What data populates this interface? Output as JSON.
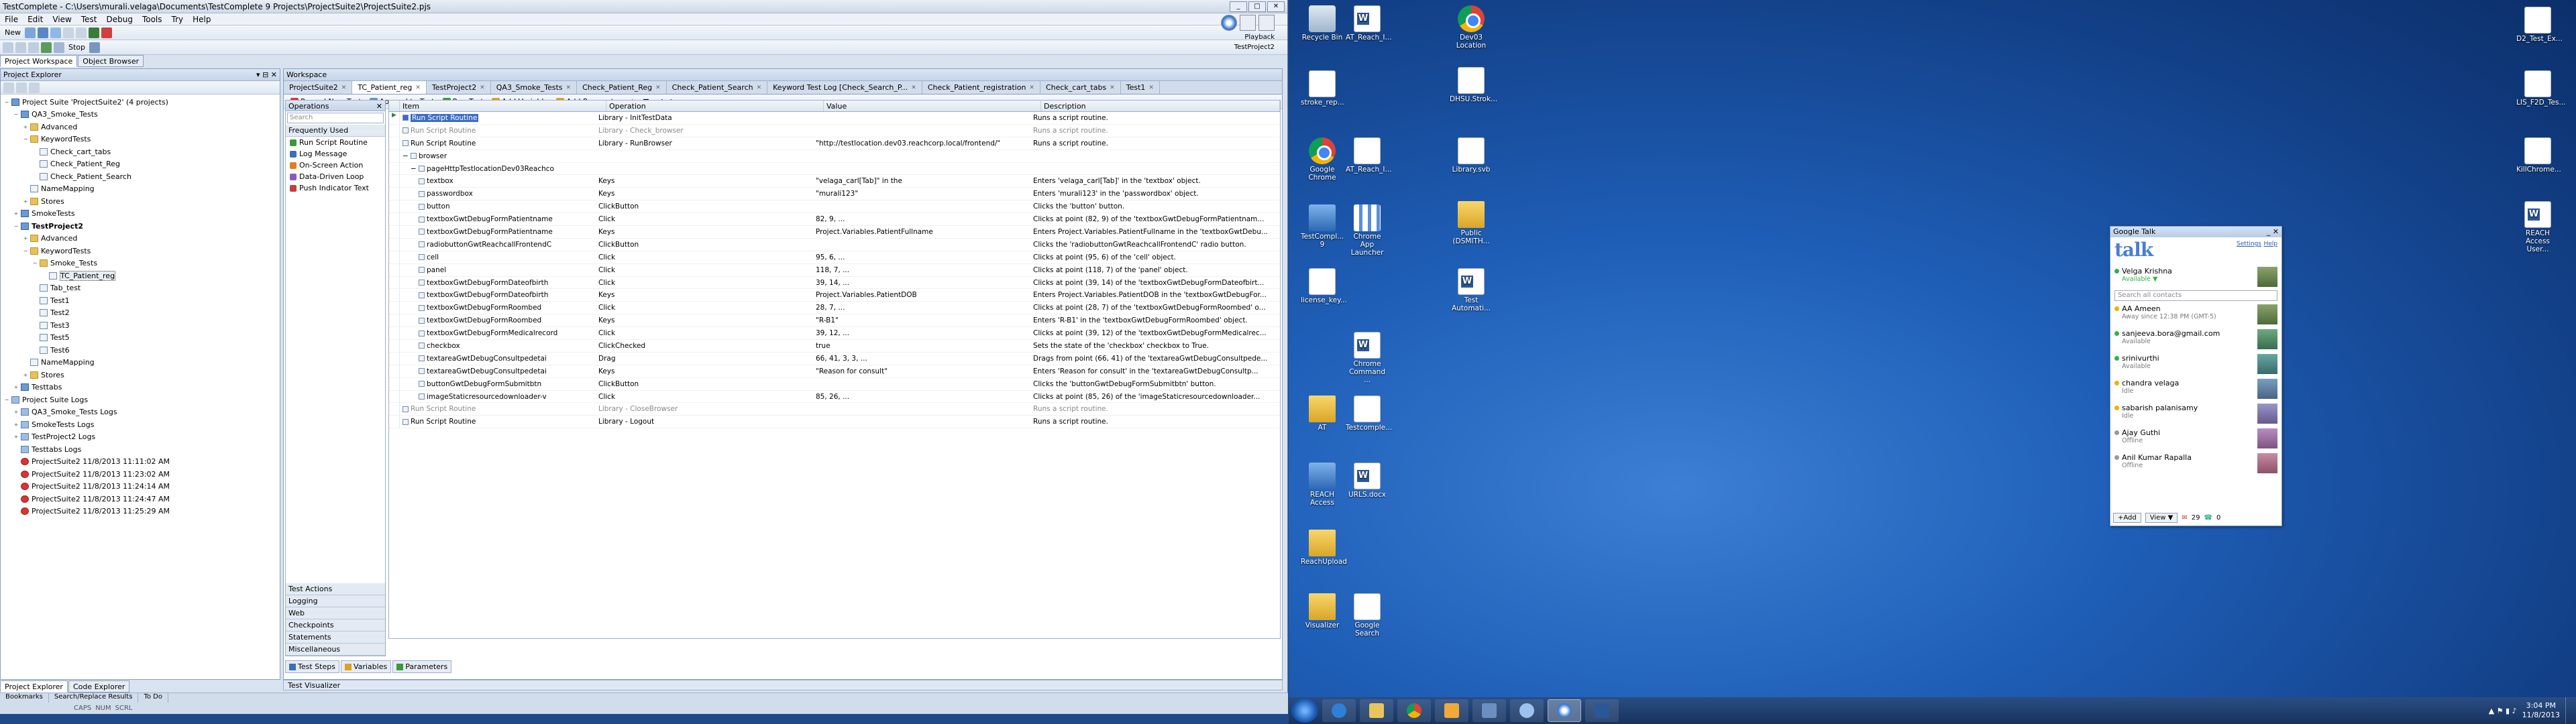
{
  "app": {
    "title": "TestComplete - C:\\Users\\murali.velaga\\Documents\\TestComplete 9 Projects\\ProjectSuite2\\ProjectSuite2.pjs",
    "menu": [
      "File",
      "Edit",
      "View",
      "Test",
      "Debug",
      "Tools",
      "Try",
      "Help"
    ],
    "toolbar": {
      "new_label": "New",
      "stop_label": "Stop"
    }
  },
  "playback": {
    "label": "Playback",
    "tooltip": "TestProject2"
  },
  "project_explorer": {
    "title": "Project Explorer",
    "tabs": [
      "Project Workspace",
      "Object Browser"
    ],
    "tree": [
      {
        "label": "Project Suite 'ProjectSuite2' (4 projects)",
        "depth": 0,
        "icon": "proj",
        "toggle": "−",
        "bold": false
      },
      {
        "label": "QA3_Smoke_Tests",
        "depth": 1,
        "icon": "proj",
        "toggle": "−"
      },
      {
        "label": "Advanced",
        "depth": 2,
        "icon": "folder",
        "toggle": "+"
      },
      {
        "label": "KeywordTests",
        "depth": 2,
        "icon": "folder",
        "toggle": "−"
      },
      {
        "label": "Check_cart_tabs",
        "depth": 3,
        "icon": "kw",
        "toggle": ""
      },
      {
        "label": "Check_Patient_Reg",
        "depth": 3,
        "icon": "kw",
        "toggle": ""
      },
      {
        "label": "Check_Patient_Search",
        "depth": 3,
        "icon": "kw",
        "toggle": ""
      },
      {
        "label": "NameMapping",
        "depth": 2,
        "icon": "kw",
        "toggle": ""
      },
      {
        "label": "Stores",
        "depth": 2,
        "icon": "folder",
        "toggle": "+"
      },
      {
        "label": "SmokeTests",
        "depth": 1,
        "icon": "proj",
        "toggle": "+"
      },
      {
        "label": "TestProject2",
        "depth": 1,
        "icon": "proj",
        "toggle": "−",
        "bold": true
      },
      {
        "label": "Advanced",
        "depth": 2,
        "icon": "folder",
        "toggle": "+"
      },
      {
        "label": "KeywordTests",
        "depth": 2,
        "icon": "folder",
        "toggle": "−"
      },
      {
        "label": "Smoke_Tests",
        "depth": 3,
        "icon": "folder",
        "toggle": "−"
      },
      {
        "label": "TC_Patient_reg",
        "depth": 4,
        "icon": "kw",
        "toggle": "",
        "selected": true
      },
      {
        "label": "Tab_test",
        "depth": 3,
        "icon": "kw",
        "toggle": ""
      },
      {
        "label": "Test1",
        "depth": 3,
        "icon": "kw",
        "toggle": ""
      },
      {
        "label": "Test2",
        "depth": 3,
        "icon": "kw",
        "toggle": ""
      },
      {
        "label": "Test3",
        "depth": 3,
        "icon": "kw",
        "toggle": ""
      },
      {
        "label": "Test5",
        "depth": 3,
        "icon": "kw",
        "toggle": ""
      },
      {
        "label": "Test6",
        "depth": 3,
        "icon": "kw",
        "toggle": ""
      },
      {
        "label": "NameMapping",
        "depth": 2,
        "icon": "kw",
        "toggle": ""
      },
      {
        "label": "Stores",
        "depth": 2,
        "icon": "folder",
        "toggle": "+"
      },
      {
        "label": "Testtabs",
        "depth": 1,
        "icon": "proj",
        "toggle": "+"
      },
      {
        "label": "Project Suite Logs",
        "depth": 0,
        "icon": "logf",
        "toggle": "−"
      },
      {
        "label": "QA3_Smoke_Tests Logs",
        "depth": 1,
        "icon": "logf",
        "toggle": "+"
      },
      {
        "label": "SmokeTests Logs",
        "depth": 1,
        "icon": "logf",
        "toggle": "+"
      },
      {
        "label": "TestProject2 Logs",
        "depth": 1,
        "icon": "logf",
        "toggle": "+"
      },
      {
        "label": "Testtabs Logs",
        "depth": 1,
        "icon": "logf",
        "toggle": ""
      },
      {
        "label": "ProjectSuite2 11/8/2013 11:11:02 AM",
        "depth": 1,
        "icon": "log",
        "toggle": ""
      },
      {
        "label": "ProjectSuite2 11/8/2013 11:23:02 AM",
        "depth": 1,
        "icon": "log",
        "toggle": ""
      },
      {
        "label": "ProjectSuite2 11/8/2013 11:24:14 AM",
        "depth": 1,
        "icon": "log",
        "toggle": ""
      },
      {
        "label": "ProjectSuite2 11/8/2013 11:24:47 AM",
        "depth": 1,
        "icon": "log",
        "toggle": ""
      },
      {
        "label": "ProjectSuite2 11/8/2013 11:25:29 AM",
        "depth": 1,
        "icon": "log",
        "toggle": ""
      }
    ],
    "bottom_tabs": [
      "Project Explorer",
      "Code Explorer"
    ]
  },
  "workspace": {
    "title": "Workspace",
    "doc_tabs": [
      "ProjectSuite2",
      "TC_Patient_reg",
      "TestProject2",
      "QA3_Smoke_Tests",
      "Check_Patient_Reg",
      "Check_Patient_Search",
      "Keyword Test Log [Check_Search_P...",
      "Check_Patient_registration",
      "Check_cart_tabs",
      "Test1"
    ],
    "kw_toolbar": [
      "Record New Test",
      "Append to Test",
      "Run Test",
      "Add Variable",
      "Add Parameter"
    ],
    "operations": {
      "title": "Operations",
      "search_placeholder": "Search",
      "frequent_title": "Frequently Used",
      "frequent": [
        "Run Script Routine",
        "Log Message",
        "On-Screen Action",
        "Data-Driven Loop",
        "Push Indicator Text"
      ],
      "groups": [
        "Test Actions",
        "Logging",
        "Web",
        "Checkpoints",
        "Statements",
        "Miscellaneous"
      ]
    },
    "columns": [
      "Item",
      "Operation",
      "Value",
      "Description"
    ],
    "rows": [
      {
        "item": "Run Script Routine",
        "op": "Library - InitTestData",
        "value": "",
        "desc": "Runs a script routine.",
        "indent": 0,
        "gray": false,
        "first": true
      },
      {
        "item": "Run Script Routine",
        "op": "Library - Check_browser",
        "value": "",
        "desc": "Runs a script routine.",
        "indent": 0,
        "gray": true
      },
      {
        "item": "Run Script Routine",
        "op": "Library - RunBrowser",
        "value": "\"http://testlocation.dev03.reachcorp.local/frontend/\"",
        "desc": "Runs a script routine.",
        "indent": 0
      },
      {
        "item": "browser",
        "op": "",
        "value": "",
        "desc": "",
        "indent": 0,
        "toggle": "−"
      },
      {
        "item": "pageHttpTestlocationDev03Reachco",
        "op": "",
        "value": "",
        "desc": "",
        "indent": 1,
        "toggle": "−"
      },
      {
        "item": "textbox",
        "op": "Keys",
        "value": "\"velaga_carl[Tab]\" in the",
        "desc": "Enters 'velaga_carl[Tab]' in the 'textbox' object.",
        "indent": 2
      },
      {
        "item": "passwordbox",
        "op": "Keys",
        "value": "\"murali123\"",
        "desc": "Enters 'murali123' in the 'passwordbox' object.",
        "indent": 2
      },
      {
        "item": "button",
        "op": "ClickButton",
        "value": "",
        "desc": "Clicks the 'button' button.",
        "indent": 2
      },
      {
        "item": "textboxGwtDebugFormPatientname",
        "op": "Click",
        "value": "82, 9, ...",
        "desc": "Clicks at point (82, 9) of the 'textboxGwtDebugFormPatientnam...",
        "indent": 2
      },
      {
        "item": "textboxGwtDebugFormPatientname",
        "op": "Keys",
        "value": "Project.Variables.PatientFullname",
        "desc": "Enters Project.Variables.PatientFullname in the 'textboxGwtDebu...",
        "indent": 2
      },
      {
        "item": "radiobuttonGwtReachcallFrontendC",
        "op": "ClickButton",
        "value": "",
        "desc": "Clicks the 'radiobuttonGwtReachcallFrontendC' radio button.",
        "indent": 2
      },
      {
        "item": "cell",
        "op": "Click",
        "value": "95, 6, ...",
        "desc": "Clicks at point (95, 6) of the 'cell' object.",
        "indent": 2
      },
      {
        "item": "panel",
        "op": "Click",
        "value": "118, 7, ...",
        "desc": "Clicks at point (118, 7) of the 'panel' object.",
        "indent": 2
      },
      {
        "item": "textboxGwtDebugFormDateofbirth",
        "op": "Click",
        "value": "39, 14, ...",
        "desc": "Clicks at point (39, 14) of the 'textboxGwtDebugFormDateofbirt...",
        "indent": 2
      },
      {
        "item": "textboxGwtDebugFormDateofbirth",
        "op": "Keys",
        "value": "Project.Variables.PatientDOB",
        "desc": "Enters Project.Variables.PatientDOB in the 'textboxGwtDebugFor...",
        "indent": 2
      },
      {
        "item": "textboxGwtDebugFormRoombed",
        "op": "Click",
        "value": "28, 7, ...",
        "desc": "Clicks at point (28, 7) of the 'textboxGwtDebugFormRoombed' o...",
        "indent": 2
      },
      {
        "item": "textboxGwtDebugFormRoombed",
        "op": "Keys",
        "value": "\"R-B1\"",
        "desc": "Enters 'R-B1' in the 'textboxGwtDebugFormRoombed' object.",
        "indent": 2
      },
      {
        "item": "textboxGwtDebugFormMedicalrecord",
        "op": "Click",
        "value": "39, 12, ...",
        "desc": "Clicks at point (39, 12) of the 'textboxGwtDebugFormMedicalrec...",
        "indent": 2
      },
      {
        "item": "checkbox",
        "op": "ClickChecked",
        "value": "true",
        "desc": "Sets the state of the 'checkbox' checkbox to True.",
        "indent": 2
      },
      {
        "item": "textareaGwtDebugConsultpedetai",
        "op": "Drag",
        "value": "66, 41, 3, 3, ...",
        "desc": "Drags from point (66, 41) of the 'textareaGwtDebugConsultpede...",
        "indent": 2
      },
      {
        "item": "textareaGwtDebugConsultpedetai",
        "op": "Keys",
        "value": "\"Reason for consult\"",
        "desc": "Enters 'Reason for consult' in the 'textareaGwtDebugConsultp...",
        "indent": 2
      },
      {
        "item": "buttonGwtDebugFormSubmitbtn",
        "op": "ClickButton",
        "value": "",
        "desc": "Clicks the 'buttonGwtDebugFormSubmitbtn' button.",
        "indent": 2
      },
      {
        "item": "imageStaticresourcedownloader-v",
        "op": "Click",
        "value": "85, 26, ...",
        "desc": "Clicks at point (85, 26) of the 'imageStaticresourcedownloader...",
        "indent": 2
      },
      {
        "item": "Run Script Routine",
        "op": "Library - CloseBrowser",
        "value": "",
        "desc": "Runs a script routine.",
        "indent": 0,
        "gray": true
      },
      {
        "item": "Run Script Routine",
        "op": "Library - Logout",
        "value": "",
        "desc": "Runs a script routine.",
        "indent": 0
      }
    ],
    "grid_tabs": [
      "Test Steps",
      "Variables",
      "Parameters"
    ],
    "visualizer": "Test Visualizer"
  },
  "statusbar": {
    "tabs": [
      "Bookmarks",
      "Search/Replace Results",
      "To Do"
    ],
    "keys": [
      "CAPS",
      "NUM",
      "SCRL"
    ]
  },
  "desktop": {
    "icons": [
      {
        "label": "Recycle Bin",
        "img": "bin",
        "pos": "a"
      },
      {
        "label": "AT_Reach_I...",
        "img": "word",
        "pos": "b"
      },
      {
        "label": "Dev03 Location",
        "img": "chrome",
        "pos": "c"
      },
      {
        "label": "stroke_rep...",
        "img": "doc",
        "pos": "d"
      },
      {
        "label": "DHSU.Strok...",
        "img": "doc",
        "pos": "e"
      },
      {
        "label": "Google Chrome",
        "img": "chrome",
        "pos": "f"
      },
      {
        "label": "AT_Reach_I...",
        "img": "doc",
        "pos": "g"
      },
      {
        "label": "Library.svb",
        "img": "doc",
        "pos": "h"
      },
      {
        "label": "TestCompl... 9",
        "img": "tc",
        "pos": "i"
      },
      {
        "label": "Chrome App Launcher",
        "img": "grid9",
        "pos": "j"
      },
      {
        "label": "Public (DSMITH...",
        "img": "folderd",
        "pos": "k"
      },
      {
        "label": "license_key...",
        "img": "doc",
        "pos": "l"
      },
      {
        "label": "Test Automati...",
        "img": "word",
        "pos": "m"
      },
      {
        "label": "Chrome Command ...",
        "img": "word",
        "pos": "n"
      },
      {
        "label": "AT",
        "img": "folderd",
        "pos": "o"
      },
      {
        "label": "Testcomple...",
        "img": "doc",
        "pos": "p"
      },
      {
        "label": "REACH Access",
        "img": "tc",
        "pos": "q"
      },
      {
        "label": "URLS.docx",
        "img": "word",
        "pos": "r"
      },
      {
        "label": "ReachUpload",
        "img": "folderd",
        "pos": "s"
      },
      {
        "label": "Visualizer",
        "img": "folderd",
        "pos": "t"
      },
      {
        "label": "Google Search",
        "img": "doc",
        "pos": "u"
      },
      {
        "label": "D2_Test_Ex...",
        "img": "doc",
        "pos": "v"
      },
      {
        "label": "LIS_F2D_Tes...",
        "img": "doc",
        "pos": "w"
      },
      {
        "label": "KillChrome...",
        "img": "doc",
        "pos": "x"
      },
      {
        "label": "REACH Access User...",
        "img": "word",
        "pos": "y"
      }
    ]
  },
  "gtalk": {
    "title": "Google Talk",
    "logo": "talk",
    "settings": "Settings",
    "help": "Help",
    "me_name": "Velga Krishna",
    "me_status": "Available ▼",
    "search_placeholder": "Search all contacts",
    "contacts": [
      {
        "name": "AA Ameen",
        "status": "Away since 12:38 PM (GMT-5)",
        "color": "#f0b000"
      },
      {
        "name": "sanjeeva.bora@gmail.com",
        "status": "Available",
        "color": "#2fb344"
      },
      {
        "name": "srinivurthi",
        "status": "Available",
        "color": "#2fb344"
      },
      {
        "name": "chandra velaga",
        "status": "Idle",
        "color": "#f0b000"
      },
      {
        "name": "sabarish palanisamy",
        "status": "Idle",
        "color": "#f0b000"
      },
      {
        "name": "Ajay Guthi",
        "status": "Offline",
        "color": "#999999"
      },
      {
        "name": "Anil Kumar Rapalla",
        "status": "Offline",
        "color": "#999999"
      }
    ],
    "add_label": "+Add",
    "view_label": "View ▼",
    "mail_count": "29",
    "count2": "0"
  },
  "taskbar": {
    "time": "3:04 PM",
    "date": "11/8/2013"
  }
}
